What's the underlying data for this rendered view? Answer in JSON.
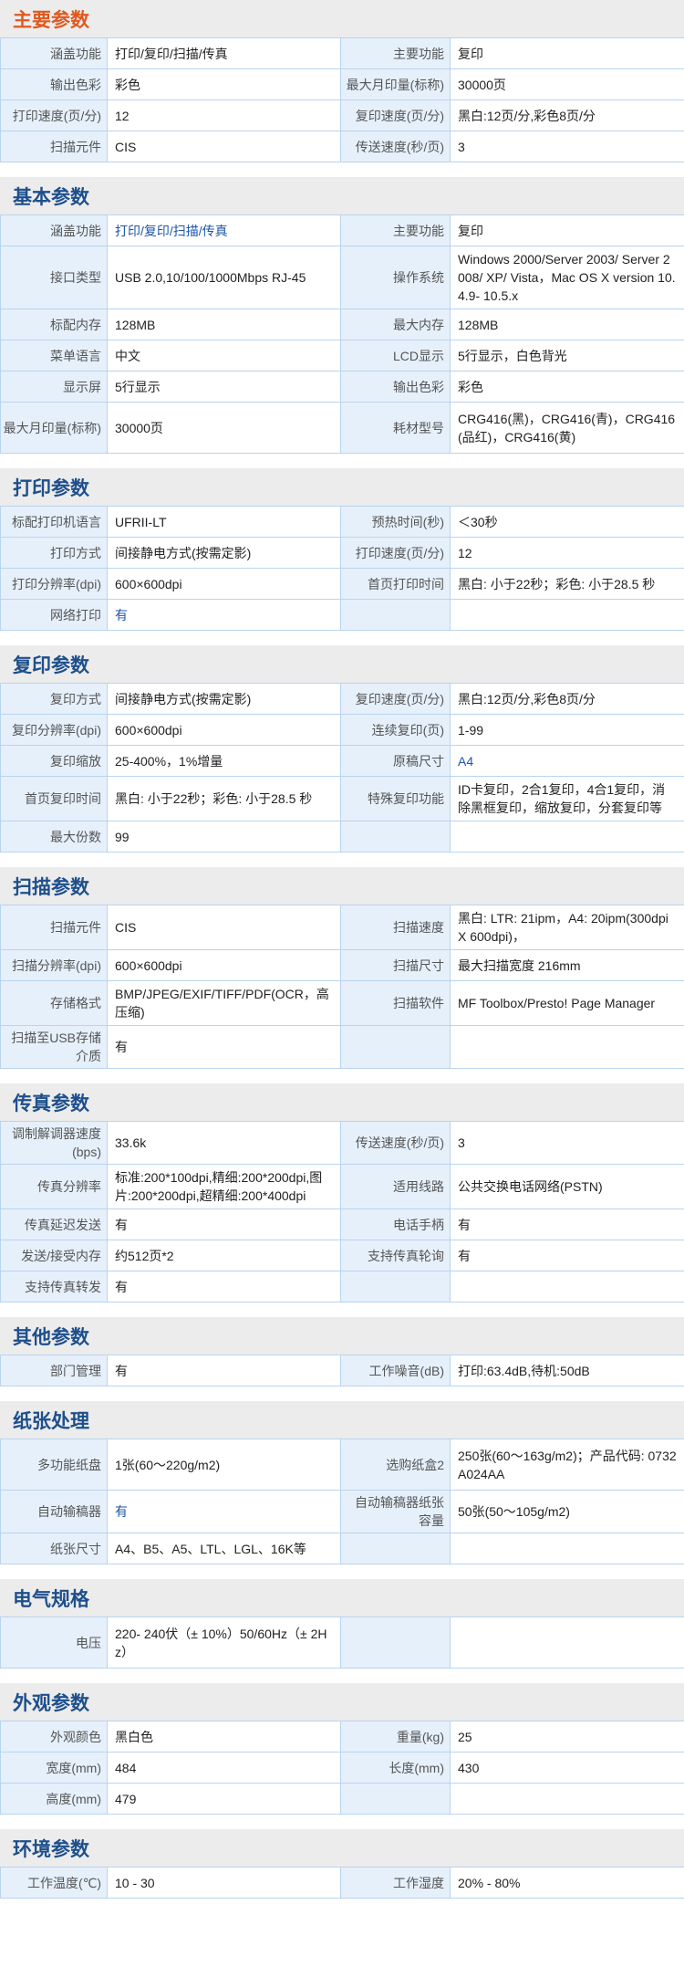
{
  "sections": [
    {
      "title": "主要参数",
      "accent": true,
      "rows": [
        {
          "l1": "涵盖功能",
          "v1": "打印/复印/扫描/传真",
          "l2": "主要功能",
          "v2": "复印"
        },
        {
          "l1": "输出色彩",
          "v1": "彩色",
          "l2": "最大月印量(标称)",
          "v2": "30000页"
        },
        {
          "l1": "打印速度(页/分)",
          "v1": "12",
          "l2": "复印速度(页/分)",
          "v2": "黑白:12页/分,彩色8页/分"
        },
        {
          "l1": "扫描元件",
          "v1": "CIS",
          "l2": "传送速度(秒/页)",
          "v2": "3"
        }
      ]
    },
    {
      "title": "基本参数",
      "rows": [
        {
          "l1": "涵盖功能",
          "v1": "打印/复印/扫描/传真",
          "v1_link": true,
          "l2": "主要功能",
          "v2": "复印"
        },
        {
          "l1": "接口类型",
          "v1": "USB 2.0,10/100/1000Mbps RJ-45",
          "l2": "操作系统",
          "v2": "Windows 2000/Server 2003/ Server 2008/ XP/ Vista，Mac OS X version 10.4.9- 10.5.x",
          "tall": true
        },
        {
          "l1": "标配内存",
          "v1": "128MB",
          "l2": "最大内存",
          "v2": "128MB"
        },
        {
          "l1": "菜单语言",
          "v1": "中文",
          "l2": "LCD显示",
          "v2": "5行显示，白色背光"
        },
        {
          "l1": "显示屏",
          "v1": "5行显示",
          "l2": "输出色彩",
          "v2": "彩色"
        },
        {
          "l1": "最大月印量(标称)",
          "v1": "30000页",
          "l2": "耗材型号",
          "v2": "CRG416(黑)，CRG416(青)，CRG416(品红)，CRG416(黄)",
          "tall": true
        }
      ]
    },
    {
      "title": "打印参数",
      "rows": [
        {
          "l1": "标配打印机语言",
          "v1": "UFRII-LT",
          "l2": "预热时间(秒)",
          "v2": "＜30秒"
        },
        {
          "l1": "打印方式",
          "v1": "间接静电方式(按需定影)",
          "l2": "打印速度(页/分)",
          "v2": "12"
        },
        {
          "l1": "打印分辨率(dpi)",
          "v1": "600×600dpi",
          "l2": "首页打印时间",
          "v2": "黑白: 小于22秒；彩色: 小于28.5 秒"
        },
        {
          "l1": "网络打印",
          "v1": "有",
          "v1_link": true,
          "l2": "",
          "v2": ""
        }
      ]
    },
    {
      "title": "复印参数",
      "rows": [
        {
          "l1": "复印方式",
          "v1": "间接静电方式(按需定影)",
          "l2": "复印速度(页/分)",
          "v2": "黑白:12页/分,彩色8页/分"
        },
        {
          "l1": "复印分辨率(dpi)",
          "v1": "600×600dpi",
          "l2": "连续复印(页)",
          "v2": "1-99"
        },
        {
          "l1": "复印缩放",
          "v1": "25-400%，1%增量",
          "l2": "原稿尺寸",
          "v2": "A4",
          "v2_link": true
        },
        {
          "l1": "首页复印时间",
          "v1": "黑白: 小于22秒；彩色: 小于28.5 秒",
          "l2": "特殊复印功能",
          "v2": "ID卡复印，2合1复印，4合1复印，消除黑框复印，缩放复印，分套复印等",
          "ex": true
        },
        {
          "l1": "最大份数",
          "v1": "99",
          "l2": "",
          "v2": ""
        }
      ]
    },
    {
      "title": "扫描参数",
      "rows": [
        {
          "l1": "扫描元件",
          "v1": "CIS",
          "l2": "扫描速度",
          "v2": "黑白: LTR: 21ipm，A4: 20ipm(300dpi X 600dpi)，",
          "ex": true
        },
        {
          "l1": "扫描分辨率(dpi)",
          "v1": "600×600dpi",
          "l2": "扫描尺寸",
          "v2": "最大扫描宽度 216mm"
        },
        {
          "l1": "存储格式",
          "v1": "BMP/JPEG/EXIF/TIFF/PDF(OCR，高压缩)",
          "l2": "扫描软件",
          "v2": "MF Toolbox/Presto! Page Manager",
          "ex": true
        },
        {
          "l1": "扫描至USB存储介质",
          "v1": "有",
          "l2": "",
          "v2": ""
        }
      ]
    },
    {
      "title": "传真参数",
      "rows": [
        {
          "l1": "调制解调器速度(bps)",
          "v1": "33.6k",
          "l2": "传送速度(秒/页)",
          "v2": "3"
        },
        {
          "l1": "传真分辨率",
          "v1": "标准:200*100dpi,精细:200*200dpi,图片:200*200dpi,超精细:200*400dpi",
          "l2": "适用线路",
          "v2": "公共交换电话网络(PSTN)",
          "ex": true
        },
        {
          "l1": "传真延迟发送",
          "v1": "有",
          "l2": "电话手柄",
          "v2": "有"
        },
        {
          "l1": "发送/接受内存",
          "v1": "约512页*2",
          "l2": "支持传真轮询",
          "v2": "有"
        },
        {
          "l1": "支持传真转发",
          "v1": "有",
          "l2": "",
          "v2": ""
        }
      ]
    },
    {
      "title": "其他参数",
      "rows": [
        {
          "l1": "部门管理",
          "v1": "有",
          "l2": "工作噪音(dB)",
          "v2": "打印:63.4dB,待机:50dB"
        }
      ]
    },
    {
      "title": "纸张处理",
      "rows": [
        {
          "l1": "多功能纸盘",
          "v1": "1张(60～220g/m2)",
          "l2": "选购纸盒2",
          "v2": "250张(60～163g/m2)；产品代码: 0732A024AA",
          "tall": true
        },
        {
          "l1": "自动输稿器",
          "v1": "有",
          "v1_link": true,
          "l2": "自动输稿器纸张容量",
          "v2": "50张(50～105g/m2)"
        },
        {
          "l1": "纸张尺寸",
          "v1": "A4、B5、A5、LTL、LGL、16K等",
          "l2": "",
          "v2": ""
        }
      ]
    },
    {
      "title": "电气规格",
      "rows": [
        {
          "l1": "电压",
          "v1": "220- 240伏（± 10%）50/60Hz（± 2Hz）",
          "l2": "",
          "v2": "",
          "tall": true
        }
      ]
    },
    {
      "title": "外观参数",
      "rows": [
        {
          "l1": "外观颜色",
          "v1": "黑白色",
          "l2": "重量(kg)",
          "v2": "25"
        },
        {
          "l1": "宽度(mm)",
          "v1": "484",
          "l2": "长度(mm)",
          "v2": "430"
        },
        {
          "l1": "高度(mm)",
          "v1": "479",
          "l2": "",
          "v2": ""
        }
      ]
    },
    {
      "title": "环境参数",
      "rows": [
        {
          "l1": "工作温度(℃)",
          "v1": "10 - 30",
          "l2": "工作湿度",
          "v2": "20% - 80%"
        }
      ]
    }
  ]
}
